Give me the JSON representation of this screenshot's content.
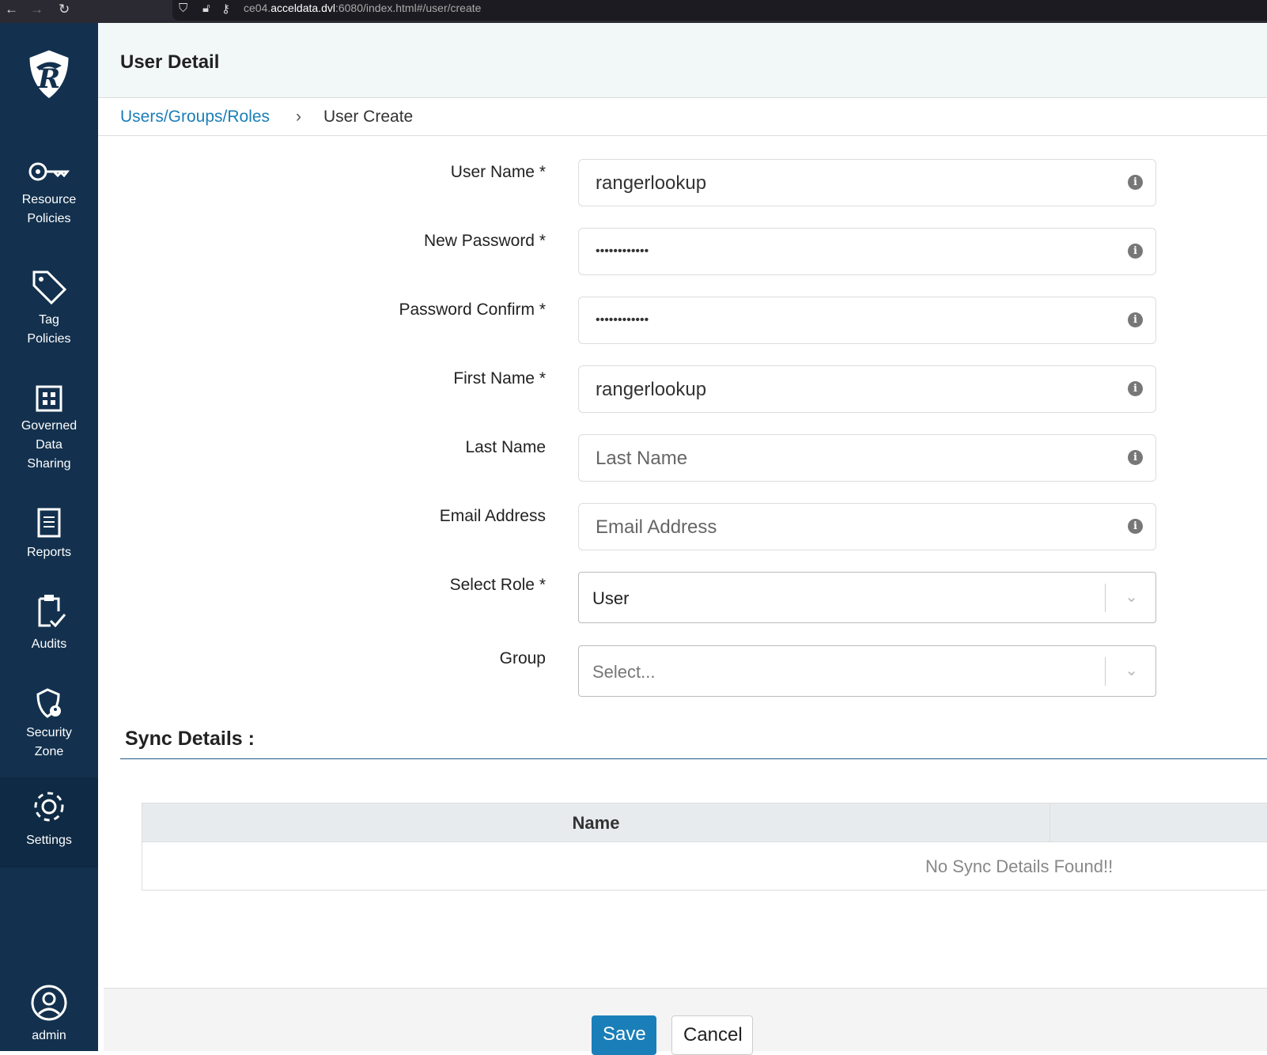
{
  "browser": {
    "url_prefix": "ce04.",
    "url_domain": "acceldata.dvl",
    "url_rest": ":6080/index.html#/user/create"
  },
  "sidebar": {
    "items": [
      {
        "label": "Resource Policies"
      },
      {
        "label": "Tag Policies"
      },
      {
        "label": "Governed Data Sharing"
      },
      {
        "label": "Reports"
      },
      {
        "label": "Audits"
      },
      {
        "label": "Security Zone"
      },
      {
        "label": "Settings"
      },
      {
        "label": "admin"
      }
    ]
  },
  "header": {
    "title": "User Detail"
  },
  "breadcrumb": {
    "link": "Users/Groups/Roles",
    "sep": "›",
    "current": "User Create"
  },
  "form": {
    "user_name": {
      "label": "User Name *",
      "value": "rangerlookup"
    },
    "new_password": {
      "label": "New Password *",
      "value": "••••••••••••"
    },
    "password_confirm": {
      "label": "Password Confirm *",
      "value": "••••••••••••"
    },
    "first_name": {
      "label": "First Name *",
      "value": "rangerlookup"
    },
    "last_name": {
      "label": "Last Name",
      "placeholder": "Last Name"
    },
    "email": {
      "label": "Email Address",
      "placeholder": "Email Address"
    },
    "role": {
      "label": "Select Role *",
      "value": "User"
    },
    "group": {
      "label": "Group",
      "placeholder": "Select..."
    }
  },
  "sync": {
    "title": "Sync Details :",
    "column": "Name",
    "empty": "No Sync Details Found!!"
  },
  "footer": {
    "save": "Save",
    "cancel": "Cancel"
  },
  "colors": {
    "sidebar": "#13314e",
    "primary": "#1a7fb8"
  }
}
